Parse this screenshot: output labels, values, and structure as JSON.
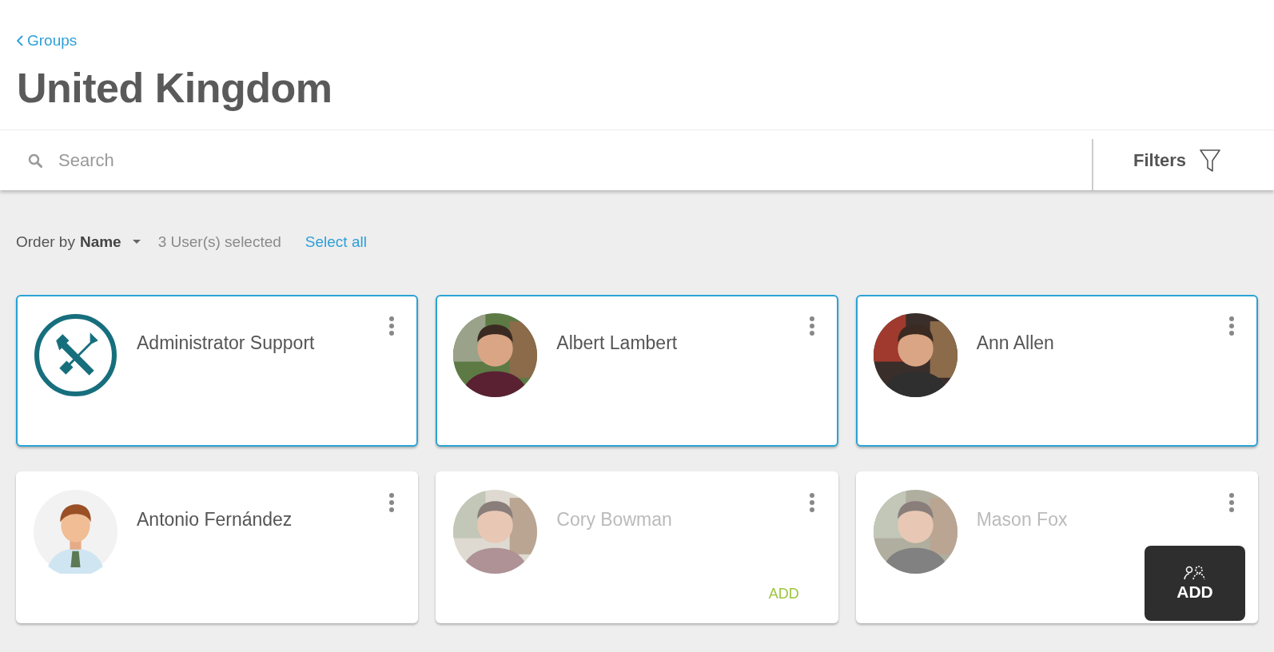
{
  "back_link": {
    "label": "Groups"
  },
  "title": "United Kingdom",
  "search": {
    "placeholder": "Search"
  },
  "filters": {
    "label": "Filters"
  },
  "toolbar": {
    "order_label": "Order by",
    "order_value": "Name",
    "selection_count": "3 User(s) selected",
    "select_all": "Select all"
  },
  "users": [
    {
      "name": "Administrator Support",
      "kind": "tools",
      "selected": true,
      "disabled": false
    },
    {
      "name": "Albert Lambert",
      "selected": true,
      "disabled": false
    },
    {
      "name": "Ann Allen",
      "selected": true,
      "disabled": false
    },
    {
      "name": "Antonio Fernández",
      "kind": "illustration",
      "selected": false,
      "disabled": false
    },
    {
      "name": "Cory Bowman",
      "selected": false,
      "disabled": true,
      "add_label": "ADD"
    },
    {
      "name": "Mason Fox",
      "selected": false,
      "disabled": true
    }
  ],
  "tooltip": {
    "label": "ADD"
  }
}
